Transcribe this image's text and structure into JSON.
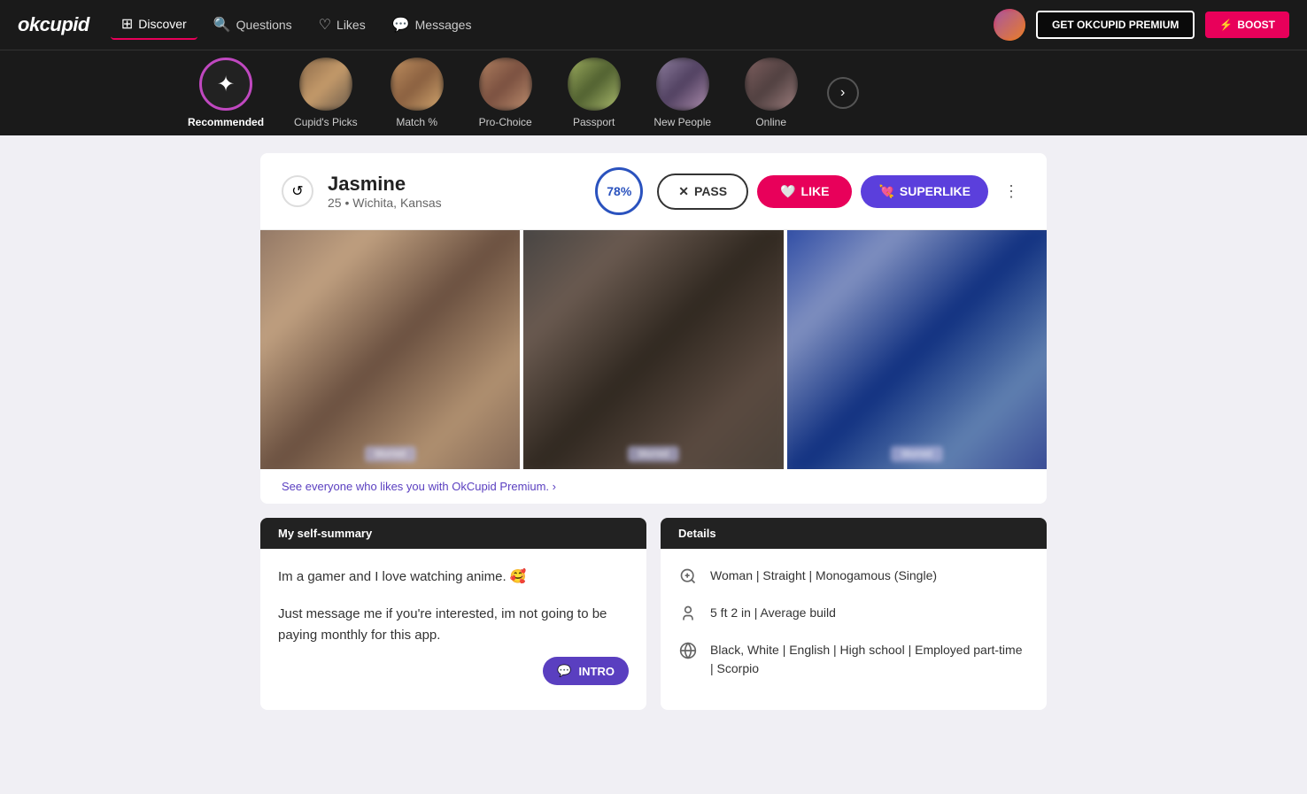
{
  "logo": "okcupid",
  "nav": {
    "items": [
      {
        "id": "discover",
        "label": "Discover",
        "icon": "⊞",
        "active": true
      },
      {
        "id": "questions",
        "label": "Questions",
        "icon": "?"
      },
      {
        "id": "likes",
        "label": "Likes",
        "icon": "♡"
      },
      {
        "id": "messages",
        "label": "Messages",
        "icon": "💬"
      }
    ],
    "premium_btn": "GET OKCUPID PREMIUM",
    "boost_btn": "⚡ BOOST"
  },
  "categories": [
    {
      "id": "recommended",
      "label": "Recommended",
      "active": true,
      "type": "icon"
    },
    {
      "id": "cupids-picks",
      "label": "Cupid's Picks",
      "type": "photo"
    },
    {
      "id": "match",
      "label": "Match %",
      "type": "photo"
    },
    {
      "id": "pro-choice",
      "label": "Pro-Choice",
      "type": "photo"
    },
    {
      "id": "passport",
      "label": "Passport",
      "type": "photo"
    },
    {
      "id": "new-people",
      "label": "New People",
      "type": "photo"
    },
    {
      "id": "online",
      "label": "Online",
      "type": "photo"
    }
  ],
  "profile": {
    "name": "Jasmine",
    "age": "25",
    "location": "Wichita, Kansas",
    "match_pct": "78%",
    "pass_label": "PASS",
    "like_label": "LIKE",
    "superlike_label": "SUPERLIKE",
    "premium_prompt": "See everyone who likes you with OkCupid Premium. ›",
    "self_summary_header": "My self-summary",
    "self_summary_line1": "Im a gamer and I love watching anime. 🥰",
    "self_summary_line2": "Just message me if you're interested, im not going to be paying monthly for this app.",
    "intro_btn": "INTRO",
    "details_header": "Details",
    "details": [
      {
        "icon": "gender",
        "text": "Woman | Straight | Monogamous (Single)"
      },
      {
        "icon": "height",
        "text": "5 ft 2 in | Average build"
      },
      {
        "icon": "globe",
        "text": "Black, White | English | High school | Employed part-time | Scorpio"
      }
    ]
  }
}
